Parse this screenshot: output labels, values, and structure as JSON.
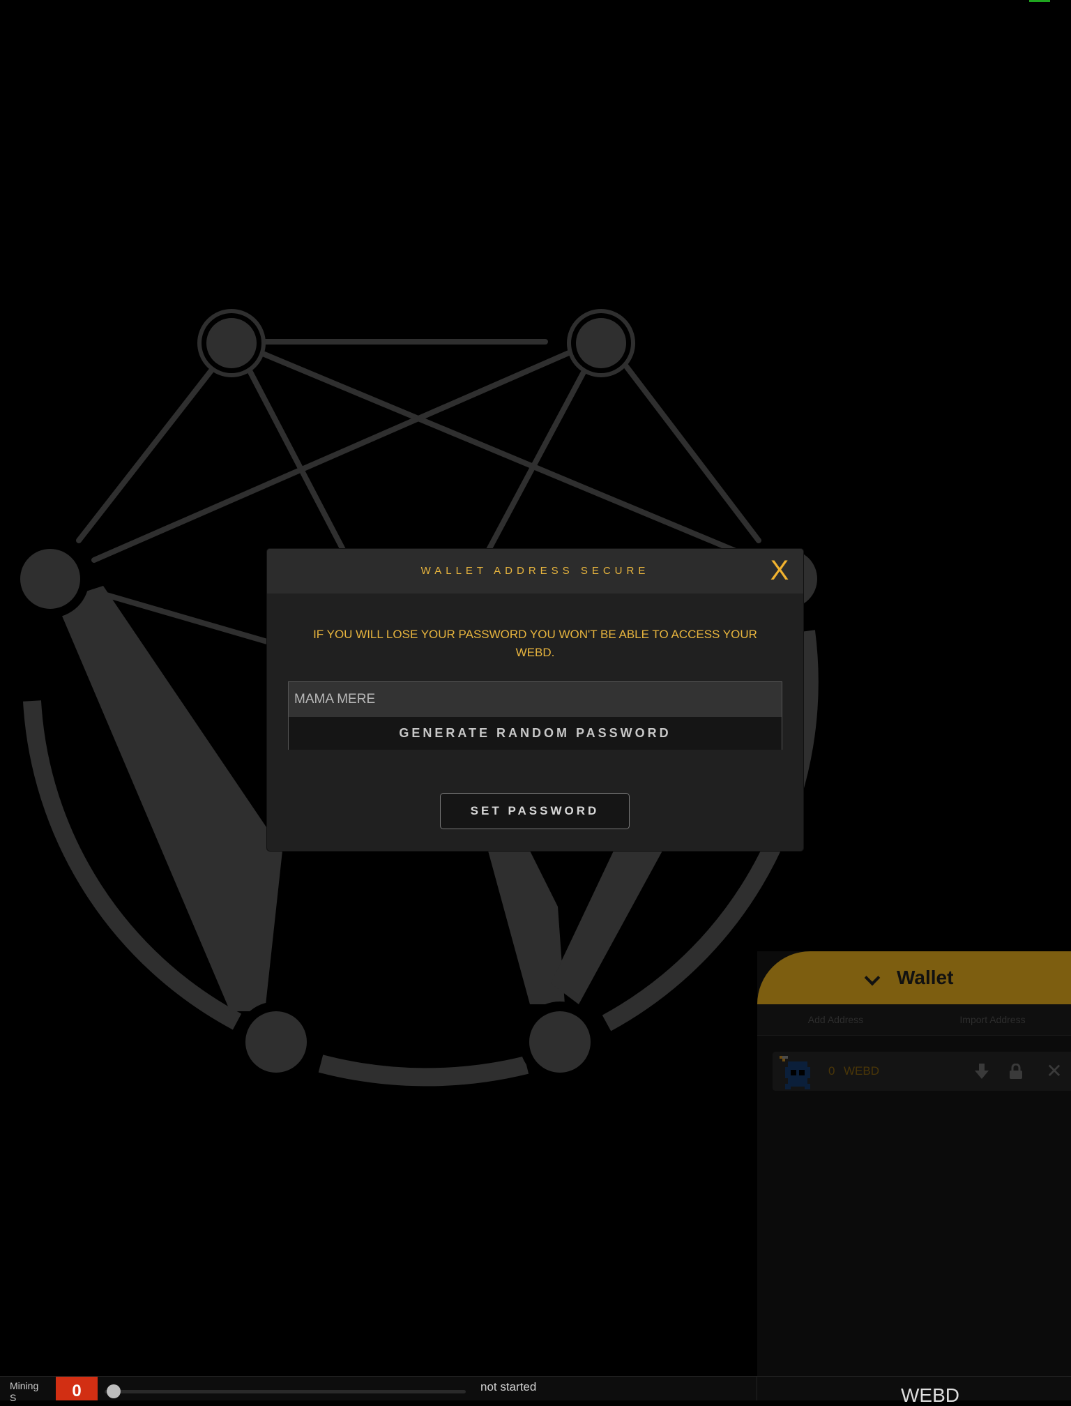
{
  "modal": {
    "title": "WALLET ADDRESS SECURE",
    "close_label": "X",
    "warning": "IF YOU WILL LOSE YOUR PASSWORD YOU WON'T BE ABLE TO ACCESS YOUR WEBD.",
    "password_value": "MAMA MERE",
    "generate_label": "GENERATE RANDOM PASSWORD",
    "set_password_label": "SET PASSWORD"
  },
  "wallet": {
    "title": "Wallet",
    "actions": [
      "Add Address",
      "Import Address"
    ],
    "address": {
      "balance": "0",
      "currency": "WEBD"
    },
    "remove_label": "✕"
  },
  "status_bar": {
    "mining_label": "Mining",
    "mining_sub": "S",
    "threads": "0",
    "status": "not started",
    "currency": "WEBD"
  },
  "colors": {
    "accent": "#e8b53e",
    "wallet_header": "#7d5e10",
    "mining_badge": "#d22f13",
    "status_indicator": "#1fa51f"
  },
  "icons": [
    "webdollar-logo",
    "close-icon",
    "chevron-down-icon",
    "miner-avatar-icon",
    "download-icon",
    "lock-icon",
    "remove-icon"
  ]
}
